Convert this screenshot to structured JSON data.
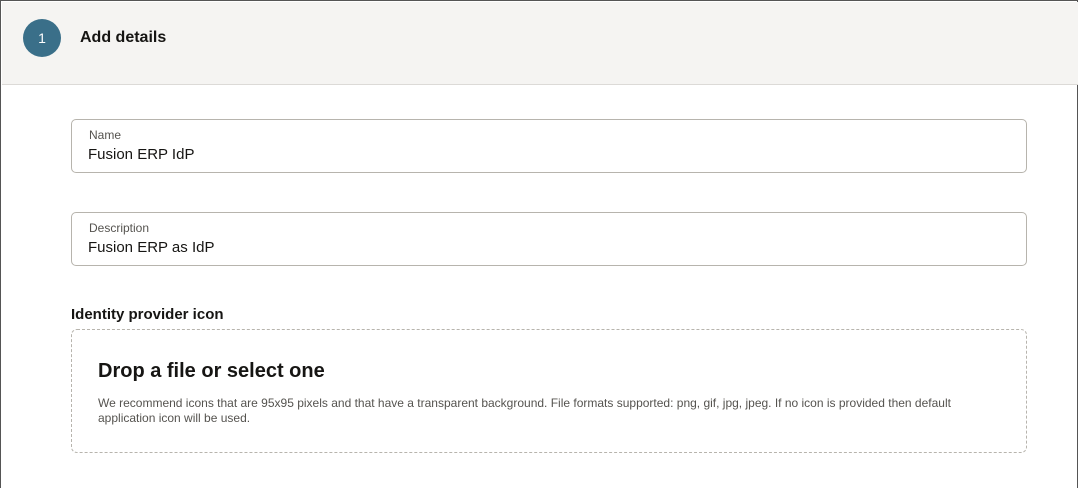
{
  "step": {
    "number": "1",
    "title": "Add details"
  },
  "form": {
    "name": {
      "label": "Name",
      "value": "Fusion ERP IdP"
    },
    "description": {
      "label": "Description",
      "value": "Fusion ERP as IdP"
    },
    "icon_section": {
      "label": "Identity provider icon",
      "drop_title": "Drop a file or select one",
      "drop_help": "We recommend icons that are 95x95 pixels and that have a transparent background. File formats supported: png, gif, jpg, jpeg. If no icon is provided then default application icon will be used."
    }
  },
  "colors": {
    "badge": "#3a6f89",
    "header_bg": "#f5f4f2"
  }
}
